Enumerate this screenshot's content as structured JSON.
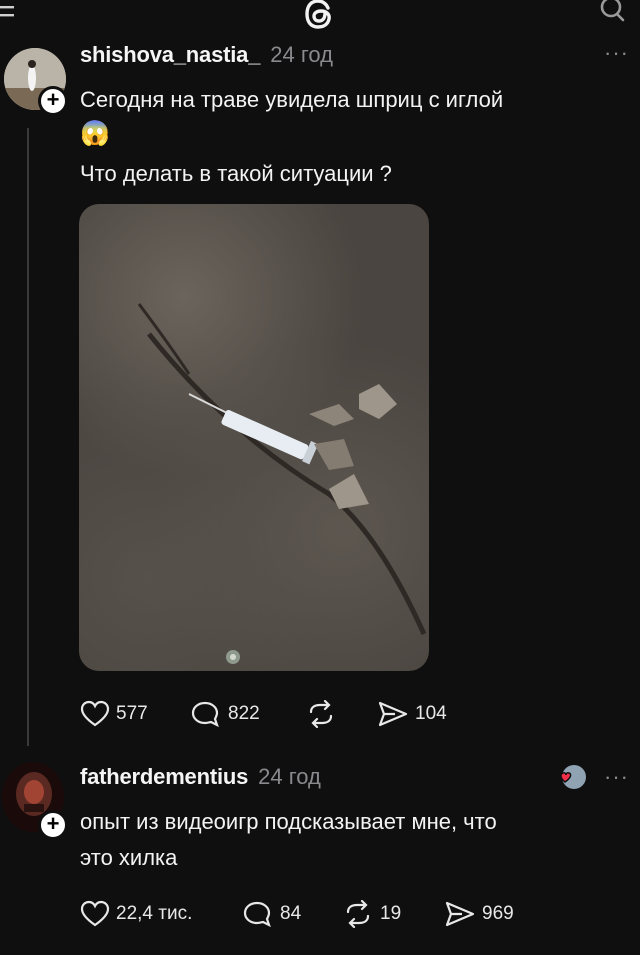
{
  "post": {
    "username": "shishova_nastia_",
    "time": "24 год",
    "text_line1": "Сегодня на траве увидела шприц с иглой",
    "emoji": "😱",
    "text_line2": "Что делать в такой ситуации ?",
    "likes": "577",
    "comments": "822",
    "shares": "104"
  },
  "reply": {
    "username": "fatherdementius",
    "time": "24 год",
    "text_line1": "опыт из видеоигр подсказывает мне, что",
    "text_line2": "это хилка",
    "likes": "22,4 тис.",
    "comments": "84",
    "reposts": "19",
    "shares": "969"
  },
  "icons": {
    "menu": "menu-icon",
    "logo": "threads-logo",
    "search": "search-icon",
    "more": "more-icon",
    "heart": "heart-icon",
    "comment": "comment-icon",
    "repost": "repost-icon",
    "share": "share-icon"
  }
}
